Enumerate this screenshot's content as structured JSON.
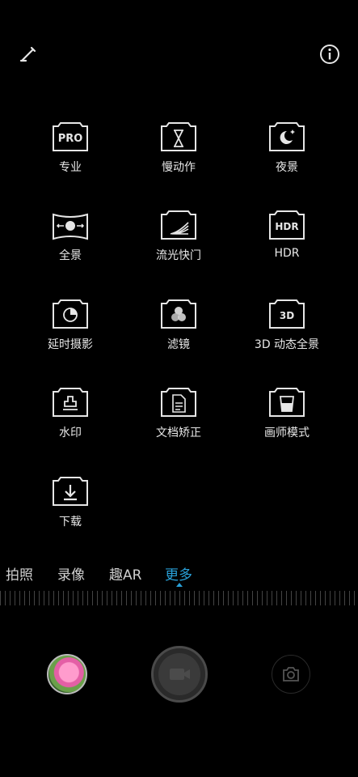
{
  "modes": [
    {
      "label": "专业",
      "icon": "pro-icon"
    },
    {
      "label": "慢动作",
      "icon": "hourglass-icon"
    },
    {
      "label": "夜景",
      "icon": "night-icon"
    },
    {
      "label": "全景",
      "icon": "panorama-icon"
    },
    {
      "label": "流光快门",
      "icon": "light-trail-icon"
    },
    {
      "label": "HDR",
      "icon": "hdr-icon"
    },
    {
      "label": "延时摄影",
      "icon": "timelapse-icon"
    },
    {
      "label": "滤镜",
      "icon": "filter-icon"
    },
    {
      "label": "3D 动态全景",
      "icon": "3d-icon"
    },
    {
      "label": "水印",
      "icon": "watermark-icon"
    },
    {
      "label": "文档矫正",
      "icon": "document-icon"
    },
    {
      "label": "画师模式",
      "icon": "artist-icon"
    },
    {
      "label": "下载",
      "icon": "download-icon"
    }
  ],
  "icon_texts": {
    "pro": "PRO",
    "hdr": "HDR",
    "three_d": "3D"
  },
  "tabs": [
    "拍照",
    "录像",
    "趣AR",
    "更多"
  ],
  "active_tab": "更多",
  "colors": {
    "accent": "#29a0d8",
    "background": "#000000",
    "text": "#e6e6e6"
  }
}
